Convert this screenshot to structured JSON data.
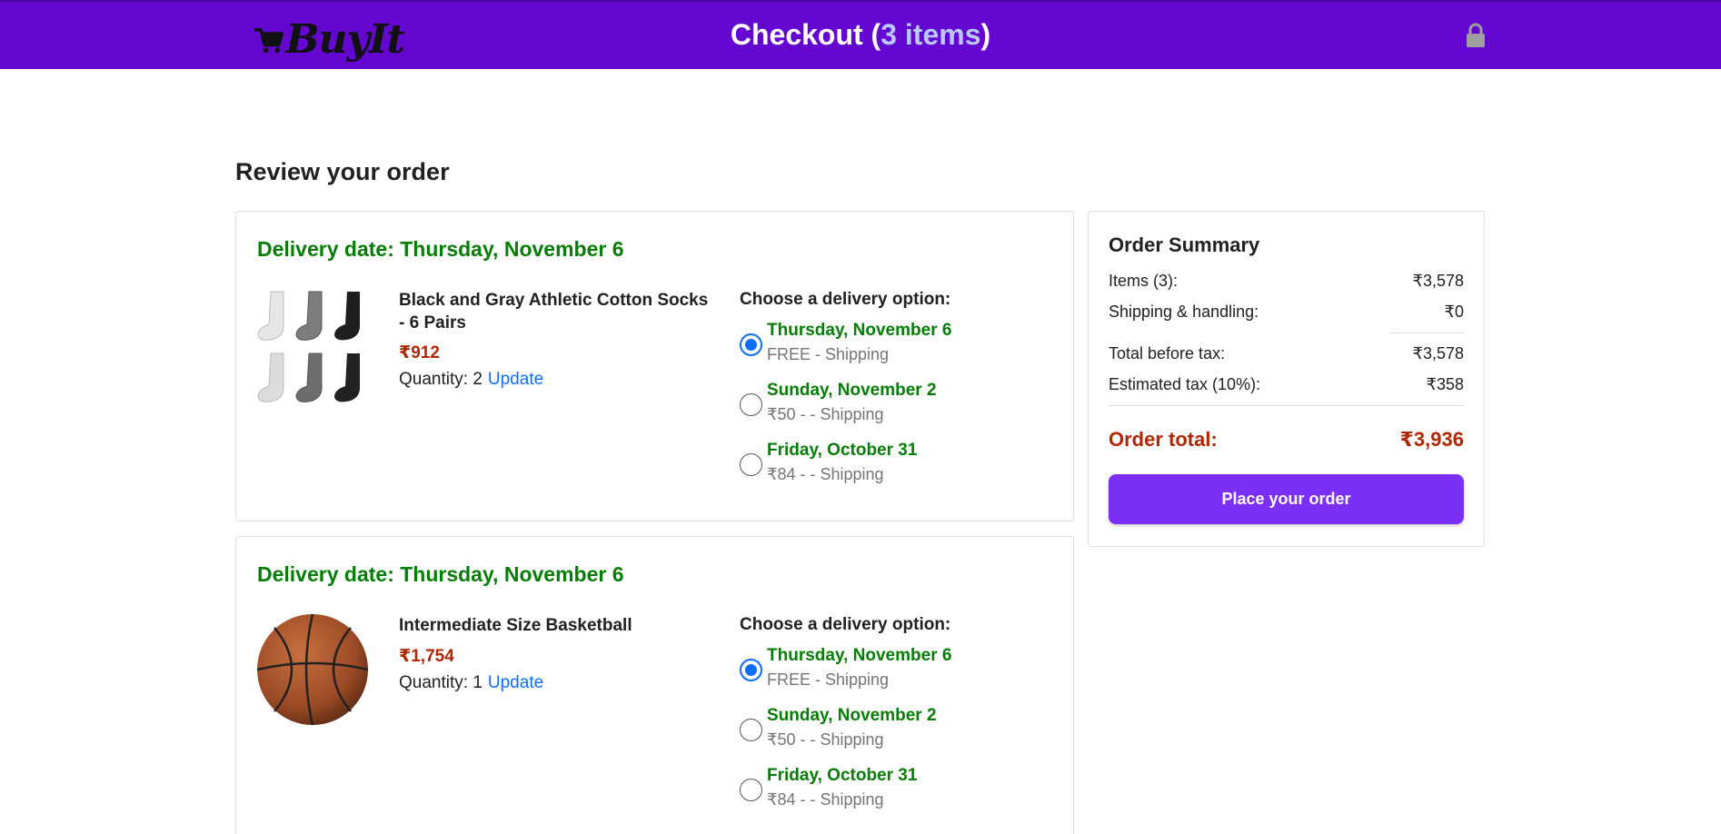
{
  "header": {
    "logo_text": "BuyIt",
    "checkout_label": "Checkout (",
    "checkout_count": "3 items",
    "checkout_close": ")",
    "lock_icon": "lock-icon",
    "background": "#6407d0"
  },
  "page": {
    "title": "Review your order"
  },
  "orders": [
    {
      "delivery_date": "Delivery date: Thursday, November 6",
      "product_name": "Black and Gray Athletic Cotton Socks - 6 Pairs",
      "price": "₹912",
      "quantity_label": "Quantity: 2",
      "update_label": "Update",
      "options_title": "Choose a delivery option:",
      "options": [
        {
          "date": "Thursday, November 6",
          "price": "FREE - Shipping",
          "selected": true
        },
        {
          "date": "Sunday, November 2",
          "price": "₹50 - - Shipping",
          "selected": false
        },
        {
          "date": "Friday, October 31",
          "price": "₹84 - - Shipping",
          "selected": false
        }
      ]
    },
    {
      "delivery_date": "Delivery date: Thursday, November 6",
      "product_name": "Intermediate Size Basketball",
      "price": "₹1,754",
      "quantity_label": "Quantity: 1",
      "update_label": "Update",
      "options_title": "Choose a delivery option:",
      "options": [
        {
          "date": "Thursday, November 6",
          "price": "FREE - Shipping",
          "selected": true
        },
        {
          "date": "Sunday, November 2",
          "price": "₹50 - - Shipping",
          "selected": false
        },
        {
          "date": "Friday, October 31",
          "price": "₹84 - - Shipping",
          "selected": false
        }
      ]
    }
  ],
  "summary": {
    "title": "Order Summary",
    "items_label": "Items (3):",
    "items_value": "₹3,578",
    "shipping_label": "Shipping & handling:",
    "shipping_value": "₹0",
    "before_tax_label": "Total before tax:",
    "before_tax_value": "₹3,578",
    "tax_label": "Estimated tax (10%):",
    "tax_value": "₹358",
    "total_label": "Order total:",
    "total_value": "₹3,936",
    "place_order_label": "Place your order"
  },
  "colors": {
    "accent_green": "#067d06",
    "price_red": "#b12704",
    "link_blue": "#0d6efd",
    "button_purple": "#7b2ff7"
  }
}
